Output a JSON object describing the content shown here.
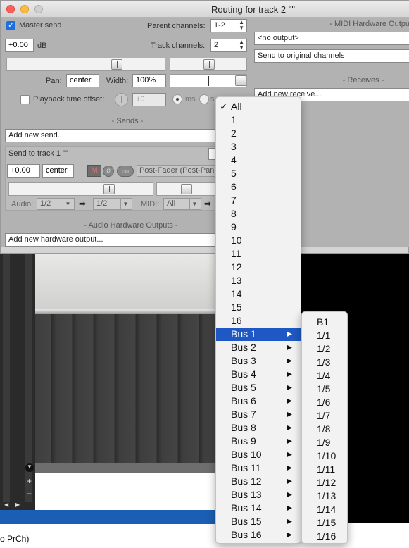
{
  "window": {
    "title": "Routing for track 2 \"\""
  },
  "master": {
    "send_label": "Master send",
    "send_checked": true,
    "volume": "+0.00",
    "volume_unit": "dB",
    "pan_label": "Pan:",
    "pan_value": "center",
    "width_label": "Width:",
    "width_value": "100%",
    "playback_offset_label": "Playback time offset:",
    "offset_value": "+0",
    "unit_ms": "ms",
    "unit_samples": "s"
  },
  "channels": {
    "parent_label": "Parent channels:",
    "parent_value": "1-2",
    "track_label": "Track channels:",
    "track_value": "2"
  },
  "midi_out": {
    "header": "- MIDI Hardware Outpu",
    "device": "<no output>",
    "mode": "Send to original channels"
  },
  "receives": {
    "header": "- Receives -",
    "add": "Add new receive..."
  },
  "sends": {
    "header": "- Sends -",
    "add": "Add new send...",
    "item_title": "Send to track 1 \"\"",
    "item_volume": "+0.00",
    "item_pan": "center",
    "mute_label": "M",
    "mode_label": "Post-Fader (Post-Pan)",
    "audio_label": "Audio:",
    "audio_src": "1/2",
    "audio_dst": "1/2",
    "midi_label": "MIDI:",
    "midi_src": "All"
  },
  "hw_outputs": {
    "header": "- Audio Hardware Outputs -",
    "add": "Add new hardware output..."
  },
  "menu": {
    "items": [
      "All",
      "1",
      "2",
      "3",
      "4",
      "5",
      "6",
      "7",
      "8",
      "9",
      "10",
      "11",
      "12",
      "13",
      "14",
      "15",
      "16",
      "Bus 1",
      "Bus 2",
      "Bus 3",
      "Bus 4",
      "Bus 5",
      "Bus 6",
      "Bus 7",
      "Bus 8",
      "Bus 9",
      "Bus 10",
      "Bus 11",
      "Bus 12",
      "Bus 13",
      "Bus 14",
      "Bus 15",
      "Bus 16"
    ],
    "checked": "All",
    "highlighted": "Bus 1",
    "submenu_glyph": "▶"
  },
  "submenu": {
    "items": [
      "B1",
      "1/1",
      "1/2",
      "1/3",
      "1/4",
      "1/5",
      "1/6",
      "1/7",
      "1/8",
      "1/9",
      "1/10",
      "1/11",
      "1/12",
      "1/13",
      "1/14",
      "1/15",
      "1/16"
    ]
  },
  "status": {
    "text": "o PrCh)"
  },
  "colors": {
    "accent": "#1f58c4",
    "close": "#fc605b",
    "minimize": "#fdbc40",
    "window_bg": "#b2b2b2"
  }
}
